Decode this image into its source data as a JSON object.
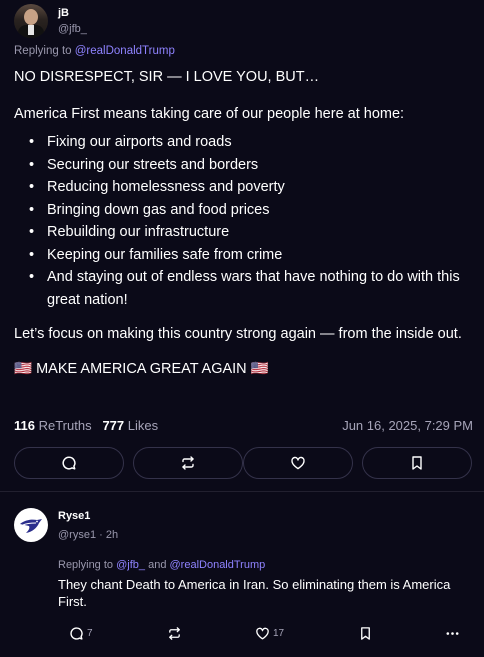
{
  "post": {
    "author_name": "jB",
    "author_handle": "@jfb_",
    "replying_prefix": "Replying to",
    "replying_mention": "@realDonaldTrump",
    "paragraph1": "NO DISRESPECT, SIR — I LOVE YOU, BUT…",
    "paragraph2": "America First means taking care of our people here at home:",
    "bullets": [
      "Fixing our airports and roads",
      "Securing our streets and borders",
      "Reducing homelessness and poverty",
      "Bringing down gas and food prices",
      "Rebuilding our infrastructure",
      "Keeping our families safe from crime",
      "And staying out of endless wars that have nothing to do with this great nation!"
    ],
    "paragraph3": "Let’s focus on making this country strong again — from the inside out.",
    "paragraph4": "🇺🇸 MAKE AMERICA GREAT AGAIN 🇺🇸",
    "retruths_count": "116",
    "retruths_label": "ReTruths",
    "likes_count": "777",
    "likes_label": "Likes",
    "timestamp": "Jun 16, 2025, 7:29 PM",
    "actions": [
      "reply-icon",
      "retruth-icon",
      "like-icon",
      "bookmark-icon"
    ]
  },
  "reply": {
    "author_name": "Ryse1",
    "author_handle": "@ryse1",
    "separator": "·",
    "age": "2h",
    "replying_prefix": "Replying to",
    "mention1": "@jfb_",
    "and_word": "and",
    "mention2": "@realDonaldTrump",
    "text": "They chant Death to America in Iran. So eliminating them is America First.",
    "reply_count": "7",
    "like_count": "17",
    "actions": [
      "reply-icon",
      "retruth-icon",
      "like-icon",
      "bookmark-icon",
      "more-icon"
    ]
  },
  "colors": {
    "background": "#0b0a18",
    "text": "#ffffff",
    "muted": "#9a98ad",
    "mention": "#8f83ff",
    "button_border": "#34324a"
  }
}
